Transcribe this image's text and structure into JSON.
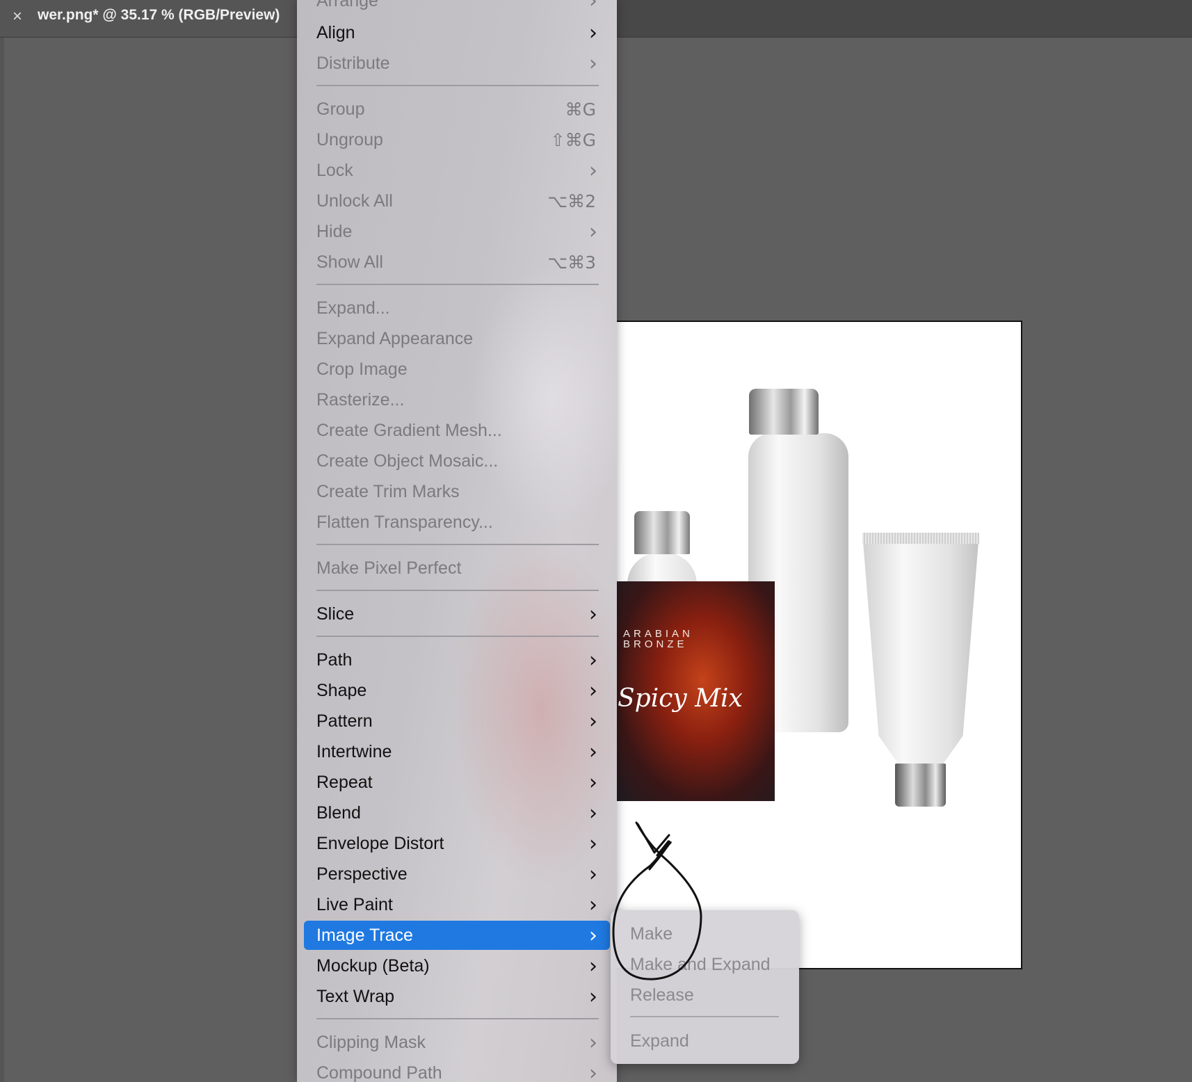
{
  "document_tab": {
    "close_glyph": "×",
    "title": "wer.png* @ 35.17 % (RGB/Preview)"
  },
  "artboard": {
    "label_brand_line1": "ARABIAN",
    "label_brand_line2": "BRONZE",
    "label_script": "Spicy Mix"
  },
  "menu": {
    "items": [
      {
        "label": "Arrange",
        "shortcut": "",
        "submenu": true,
        "enabled": false
      },
      {
        "label": "Align",
        "shortcut": "",
        "submenu": true,
        "enabled": true
      },
      {
        "label": "Distribute",
        "shortcut": "",
        "submenu": true,
        "enabled": false
      },
      {
        "label": "Group",
        "shortcut": "⌘G",
        "submenu": false,
        "enabled": false
      },
      {
        "label": "Ungroup",
        "shortcut": "⇧⌘G",
        "submenu": false,
        "enabled": false
      },
      {
        "label": "Lock",
        "shortcut": "",
        "submenu": true,
        "enabled": false
      },
      {
        "label": "Unlock All",
        "shortcut": "⌥⌘2",
        "submenu": false,
        "enabled": false
      },
      {
        "label": "Hide",
        "shortcut": "",
        "submenu": true,
        "enabled": false
      },
      {
        "label": "Show All",
        "shortcut": "⌥⌘3",
        "submenu": false,
        "enabled": false
      },
      {
        "label": "Expand...",
        "shortcut": "",
        "submenu": false,
        "enabled": false
      },
      {
        "label": "Expand Appearance",
        "shortcut": "",
        "submenu": false,
        "enabled": false
      },
      {
        "label": "Crop Image",
        "shortcut": "",
        "submenu": false,
        "enabled": false
      },
      {
        "label": "Rasterize...",
        "shortcut": "",
        "submenu": false,
        "enabled": false
      },
      {
        "label": "Create Gradient Mesh...",
        "shortcut": "",
        "submenu": false,
        "enabled": false
      },
      {
        "label": "Create Object Mosaic...",
        "shortcut": "",
        "submenu": false,
        "enabled": false
      },
      {
        "label": "Create Trim Marks",
        "shortcut": "",
        "submenu": false,
        "enabled": false
      },
      {
        "label": "Flatten Transparency...",
        "shortcut": "",
        "submenu": false,
        "enabled": false
      },
      {
        "label": "Make Pixel Perfect",
        "shortcut": "",
        "submenu": false,
        "enabled": false
      },
      {
        "label": "Slice",
        "shortcut": "",
        "submenu": true,
        "enabled": true
      },
      {
        "label": "Path",
        "shortcut": "",
        "submenu": true,
        "enabled": true
      },
      {
        "label": "Shape",
        "shortcut": "",
        "submenu": true,
        "enabled": true
      },
      {
        "label": "Pattern",
        "shortcut": "",
        "submenu": true,
        "enabled": true
      },
      {
        "label": "Intertwine",
        "shortcut": "",
        "submenu": true,
        "enabled": true
      },
      {
        "label": "Repeat",
        "shortcut": "",
        "submenu": true,
        "enabled": true
      },
      {
        "label": "Blend",
        "shortcut": "",
        "submenu": true,
        "enabled": true
      },
      {
        "label": "Envelope Distort",
        "shortcut": "",
        "submenu": true,
        "enabled": true
      },
      {
        "label": "Perspective",
        "shortcut": "",
        "submenu": true,
        "enabled": true
      },
      {
        "label": "Live Paint",
        "shortcut": "",
        "submenu": true,
        "enabled": true
      },
      {
        "label": "Image Trace",
        "shortcut": "",
        "submenu": true,
        "enabled": true,
        "selected": true
      },
      {
        "label": "Mockup (Beta)",
        "shortcut": "",
        "submenu": true,
        "enabled": true
      },
      {
        "label": "Text Wrap",
        "shortcut": "",
        "submenu": true,
        "enabled": true
      },
      {
        "label": "Clipping Mask",
        "shortcut": "",
        "submenu": true,
        "enabled": false
      },
      {
        "label": "Compound Path",
        "shortcut": "",
        "submenu": true,
        "enabled": false
      }
    ],
    "chevron": "›"
  },
  "image_trace_submenu": {
    "items": [
      {
        "label": "Make",
        "enabled": false
      },
      {
        "label": "Make and Expand",
        "enabled": false
      },
      {
        "label": "Release",
        "enabled": false
      },
      {
        "label": "Expand",
        "enabled": false
      }
    ]
  },
  "colors": {
    "selection": "#1f79e0",
    "disabled_text": "#7b7a7e",
    "canvas": "#5f5f5f"
  }
}
